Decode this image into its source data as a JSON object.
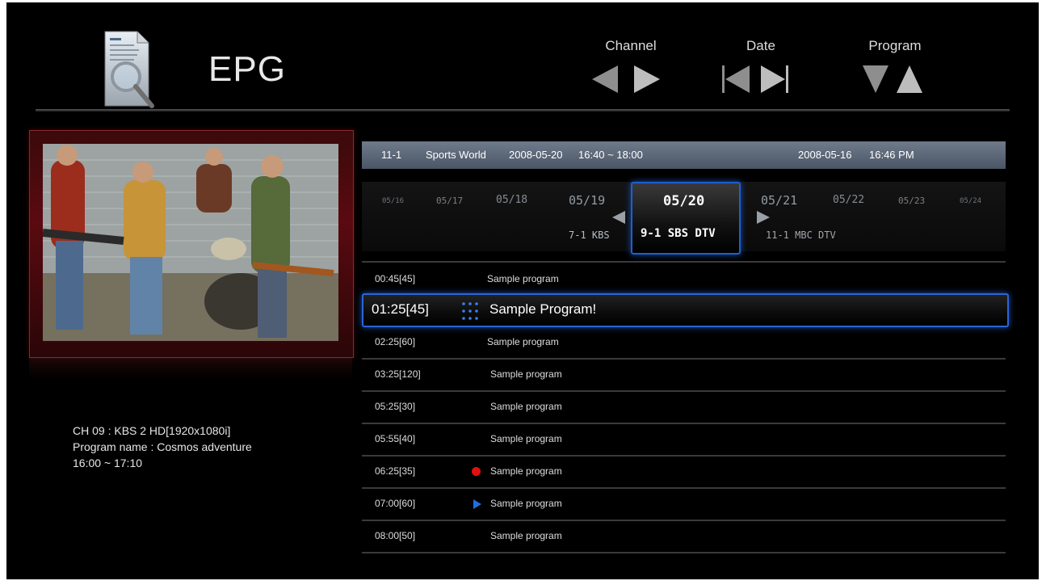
{
  "header": {
    "title": "EPG",
    "controls": [
      {
        "label": "Channel",
        "icons": [
          "arrow-left-icon",
          "arrow-right-icon"
        ]
      },
      {
        "label": "Date",
        "icons": [
          "skip-back-icon",
          "skip-forward-icon"
        ]
      },
      {
        "label": "Program",
        "icons": [
          "arrow-down-icon",
          "arrow-up-icon"
        ]
      }
    ]
  },
  "preview": {
    "channel_info": "CH 09 : KBS 2 HD[1920x1080i]",
    "program_name": "Program name : Cosmos adventure",
    "time_range": "16:00 ~ 17:10"
  },
  "top_bar": {
    "channel_number": "11-1",
    "channel_name": "Sports World",
    "program_date": "2008-05-20",
    "program_time": "16:40 ~ 18:00",
    "current_date": "2008-05-16",
    "current_time": "16:46 PM"
  },
  "date_strip": {
    "dates": [
      "05/16",
      "05/17",
      "05/18",
      "05/19",
      "05/20",
      "05/21",
      "05/22",
      "05/23",
      "05/24"
    ],
    "selected_index": 4,
    "prev_channel": "7-1 KBS",
    "current_channel": "9-1 SBS DTV",
    "next_channel": "11-1 MBC DTV"
  },
  "programs": [
    {
      "time": "00:45[45]",
      "name": "Sample program",
      "marker": ""
    },
    {
      "time": "01:25[45]",
      "name": "Sample Program!",
      "marker": "selected"
    },
    {
      "time": "02:25[60]",
      "name": "Sample program",
      "marker": ""
    },
    {
      "time": "03:25[120]",
      "name": "Sample program",
      "marker": ""
    },
    {
      "time": "05:25[30]",
      "name": "Sample program",
      "marker": ""
    },
    {
      "time": "05:55[40]",
      "name": "Sample program",
      "marker": ""
    },
    {
      "time": "06:25[35]",
      "name": "Sample program",
      "marker": "record"
    },
    {
      "time": "07:00[60]",
      "name": "Sample program",
      "marker": "play"
    },
    {
      "time": "08:00[50]",
      "name": "Sample program",
      "marker": ""
    }
  ],
  "colors": {
    "accent": "#2a66d6",
    "record": "#e01010",
    "play": "#1f6fe0"
  }
}
